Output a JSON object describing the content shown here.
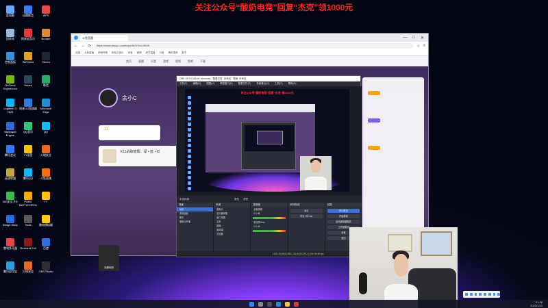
{
  "banner": "关注公众号“酸奶电竞”回复“杰克”领1000元",
  "desktop_icons": [
    {
      "label": "此电脑",
      "color": "#6aa9ff"
    },
    {
      "label": "迅雷影音",
      "color": "#3b7bea"
    },
    {
      "label": "WPS",
      "color": "#e14b4b"
    },
    {
      "label": "回收站",
      "color": "#9bb7d4"
    },
    {
      "label": "网易云音乐",
      "color": "#e23a3a"
    },
    {
      "label": "Brotato",
      "color": "#d98b2b"
    },
    {
      "label": "控制面板",
      "color": "#3a8fd8"
    },
    {
      "label": "WeGame",
      "color": "#e0a31b"
    },
    {
      "label": "Steam",
      "color": "#1b2838"
    },
    {
      "label": "GeForce Experience",
      "color": "#76b900"
    },
    {
      "label": "Steam",
      "color": "#2a475e"
    },
    {
      "label": "微信",
      "color": "#2aae67"
    },
    {
      "label": "Logitech G HUB",
      "color": "#00b8fc"
    },
    {
      "label": "网易UU加速器",
      "color": "#2d7ce0"
    },
    {
      "label": "Microsoft Edge",
      "color": "#1e90d4"
    },
    {
      "label": "Wallpaper Engine",
      "color": "#2e6ad6"
    },
    {
      "label": "QQ音乐",
      "color": "#31c27c"
    },
    {
      "label": "QQ",
      "color": "#12b7f5"
    },
    {
      "label": "腾讯会议",
      "color": "#2f78ff"
    },
    {
      "label": "YY语音",
      "color": "#f6c500"
    },
    {
      "label": "火绒安全",
      "color": "#e86a1c"
    },
    {
      "label": "英雄联盟",
      "color": "#c8a43a"
    },
    {
      "label": "腾讯QQ",
      "color": "#12b7f5"
    },
    {
      "label": "斗鱼直播",
      "color": "#ff6f00"
    },
    {
      "label": "360安全卫士",
      "color": "#3db94f"
    },
    {
      "label": "PUBG BATTLEGROUNDS",
      "color": "#f2a900"
    },
    {
      "label": "YY",
      "color": "#f6c500"
    },
    {
      "label": "Bridge Shop",
      "color": "#2b6ae0"
    },
    {
      "label": "Tools",
      "color": "#5a5a5a"
    },
    {
      "label": "雷电模拟器",
      "color": "#ffcc00"
    },
    {
      "label": "雷电多开器",
      "color": "#e04848"
    },
    {
      "label": "Resident Evil",
      "color": "#8b1a1a"
    },
    {
      "label": "百度",
      "color": "#2f6fe0"
    },
    {
      "label": "腾讯应用宝",
      "color": "#2aa0e0"
    },
    {
      "label": "火绒安全",
      "color": "#e86a1c"
    },
    {
      "label": "OBS Studio",
      "color": "#302e31"
    }
  ],
  "browser": {
    "tab_title": "斗鱼直播",
    "url": "https://www.douyu.com/topic/MSI?rid=9999",
    "window_buttons": [
      "—",
      "□",
      "✕"
    ],
    "bookmarks": [
      "百度",
      "斗鱼直播",
      "哔哩哔哩",
      "网易云音乐",
      "淘宝",
      "微博",
      "虎牙直播",
      "抖音",
      "腾讯视频",
      "知乎"
    ],
    "site": {
      "nav": [
        "首页",
        "直播",
        "分类",
        "游戏",
        "视频",
        "鱼吧",
        "下载"
      ],
      "anchor_name": "余小C",
      "rank_badge": "11",
      "chat_title": "K11战歌暗辉：绿 • 蓝 • 红",
      "gift_label": "天朗玩粉"
    }
  },
  "obs": {
    "title": "OBS 29.0.0 (64-bit, windows) - 配置文件: 未命名 - 场景: 未命名",
    "menu": [
      "文件(F)",
      "编辑(E)",
      "视图(V)",
      "停靠窗口(D)",
      "配置文件(P)",
      "场景集合(S)",
      "工具(T)",
      "帮助(H)"
    ],
    "preview_banner": "关注公众号“酸奶电竞”回复“杰克”领1000元",
    "source_tabs": [
      "未选择源",
      "属性",
      "滤镜"
    ],
    "docks": {
      "scenes": {
        "header": "场景",
        "items": [
          "场景",
          "游戏画面",
          "聊天",
          "摄像头开播"
        ]
      },
      "sources": {
        "header": "来源",
        "items": [
          "摄像头",
          "显示器采集",
          "窗口采集",
          "文本",
          "图像",
          "媒体源",
          "浏览器"
        ]
      },
      "mixer": {
        "header": "混音器",
        "items": [
          "桌面音频",
          "麦克风/Aux"
        ],
        "levels": [
          "0.0 dB",
          "0.0 dB"
        ]
      },
      "transitions": {
        "header": "转场特效",
        "items": [
          "淡出",
          "时长 300 ms"
        ]
      },
      "controls": {
        "header": "控制",
        "items": [
          "停止推流",
          "开始录制",
          "启动虚拟摄像机",
          "工作室模式",
          "设置",
          "退出"
        ]
      }
    },
    "status": "LIVE: 00:00:00   REC: 00:00:00   CPU: 0.0%, 60.00 fps"
  },
  "taskbar": {
    "icons": [
      "开始",
      "搜索",
      "任务视图",
      "Edge",
      "文件资源管理器",
      "OBS"
    ],
    "time": "21:38",
    "date": "2023/1/10"
  }
}
